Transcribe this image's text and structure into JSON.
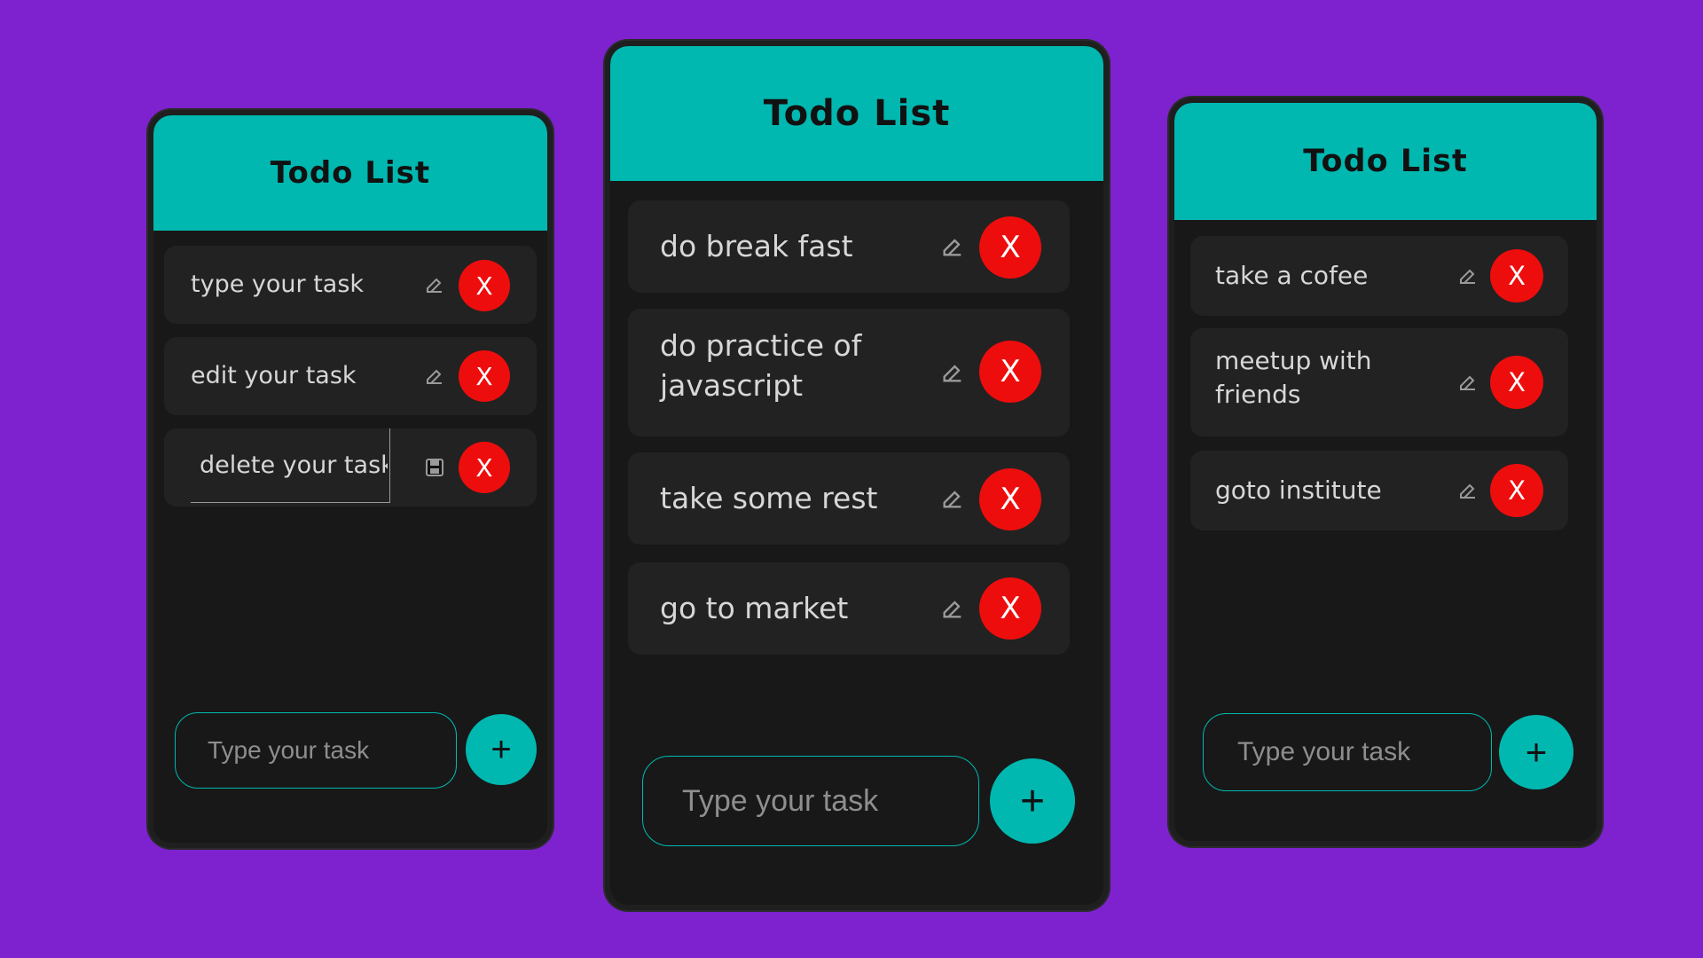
{
  "colors": {
    "background": "#7d22ce",
    "card": "#181818",
    "header": "#00b8b0",
    "task_item": "#222222",
    "delete": "#ee0d0d",
    "accent": "#00b8b0"
  },
  "cards": [
    {
      "title": "Todo List",
      "tasks": [
        {
          "text": "type your task",
          "icon": "edit-icon"
        },
        {
          "text": "edit your task",
          "icon": "edit-icon"
        },
        {
          "text": "delete your task",
          "icon": "save-icon",
          "editing": true
        }
      ],
      "delete_label": "X",
      "input_placeholder": "Type your task",
      "add_label": "+"
    },
    {
      "title": "Todo List",
      "tasks": [
        {
          "text": "do break fast",
          "icon": "edit-icon"
        },
        {
          "text": "do practice of javascript",
          "icon": "edit-icon"
        },
        {
          "text": "take some rest",
          "icon": "edit-icon"
        },
        {
          "text": "go to market",
          "icon": "edit-icon"
        }
      ],
      "delete_label": "X",
      "input_placeholder": "Type your task",
      "add_label": "+"
    },
    {
      "title": "Todo List",
      "tasks": [
        {
          "text": "take a cofee",
          "icon": "edit-icon"
        },
        {
          "text": "meetup with friends",
          "icon": "edit-icon"
        },
        {
          "text": "goto institute",
          "icon": "edit-icon"
        }
      ],
      "delete_label": "X",
      "input_placeholder": "Type your task",
      "add_label": "+"
    }
  ]
}
